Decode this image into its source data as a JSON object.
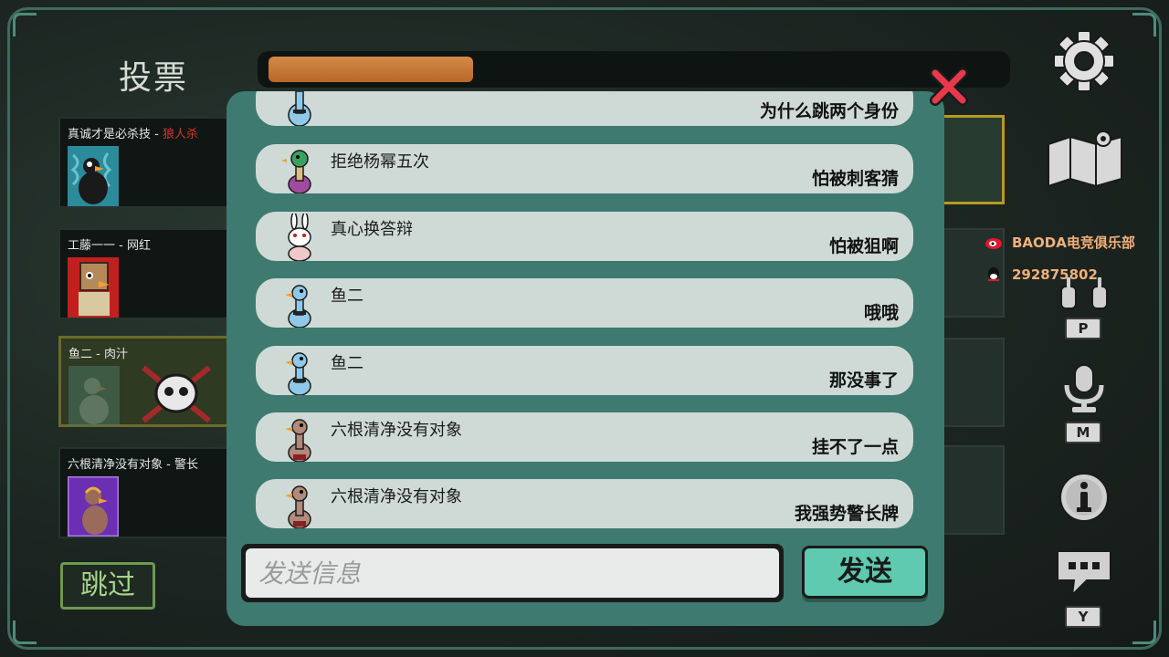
{
  "meeting": {
    "title": "投票",
    "timer_progress": 0.28
  },
  "players": [
    {
      "name": "真诚才是必杀技",
      "tag": "- ",
      "tag_red": "狼人杀"
    },
    {
      "name": "工藤一一 - 网红",
      "tag": "",
      "tag_red": ""
    },
    {
      "name": "鱼二 - 肉汁",
      "tag": "",
      "tag_red": ""
    },
    {
      "name": "六根清净没有对象 - 警长",
      "tag": "",
      "tag_red": ""
    }
  ],
  "skip_label": "跳过",
  "chat": {
    "messages": [
      {
        "sender": "",
        "text": "为什么跳两个身份",
        "avatar": "goose-blue"
      },
      {
        "sender": "拒绝杨幂五次",
        "text": "怕被刺客猜",
        "avatar": "duck-green"
      },
      {
        "sender": "真心换答辩",
        "text": "怕被狙啊",
        "avatar": "rabbit-white"
      },
      {
        "sender": "鱼二",
        "text": "哦哦",
        "avatar": "goose-blue"
      },
      {
        "sender": "鱼二",
        "text": "那没事了",
        "avatar": "goose-blue"
      },
      {
        "sender": "六根清净没有对象",
        "text": "挂不了一点",
        "avatar": "goose-brown"
      },
      {
        "sender": "六根清净没有对象",
        "text": "我强势警长牌",
        "avatar": "goose-brown"
      }
    ],
    "input_placeholder": "发送信息",
    "send_label": "发送"
  },
  "toolbar": {
    "settings_icon": "gear-icon",
    "map_icon": "map-icon",
    "push_to_talk_key": "P",
    "mic_key": "M",
    "chat_key": "Y"
  },
  "overlay": {
    "club_name": "BAODA电竞俱乐部",
    "qq_number": "292875802"
  },
  "colors": {
    "chat_bg": "#3e7a6f",
    "bubble": "#cfdad7",
    "send_button": "#5fcab0",
    "timer_fill": "#c97a38",
    "close_x": "#e8394b"
  }
}
